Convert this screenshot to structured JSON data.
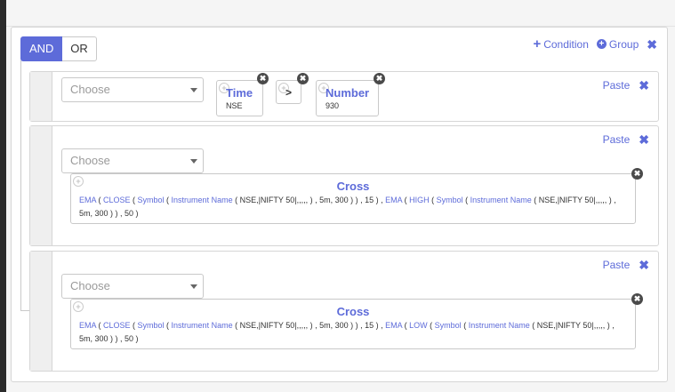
{
  "logic": {
    "and_label": "AND",
    "or_label": "OR"
  },
  "actions": {
    "condition_label": "Condition",
    "group_label": "Group"
  },
  "rules": {
    "r1": {
      "paste_label": "Paste",
      "select_placeholder": "Choose",
      "left_chip": {
        "title": "Time",
        "sub": "NSE"
      },
      "operator": ">",
      "right_chip": {
        "title": "Number",
        "sub": "930"
      }
    },
    "r2": {
      "paste_label": "Paste",
      "select_placeholder": "Choose",
      "title": "Cross",
      "expr": [
        "EMA",
        " ( ",
        "CLOSE",
        " ( ",
        "Symbol",
        " ( ",
        "Instrument Name",
        " ( NSE,|NIFTY 50|,,,,, ) , 5m, 300 ) ) , 15 ) , ",
        "EMA",
        " ( ",
        "HIGH",
        " ( ",
        "Symbol",
        " ( ",
        "Instrument Name",
        " ( NSE,|NIFTY 50|,,,,, ) , 5m, 300 ) ) , 50 )"
      ]
    },
    "r3": {
      "paste_label": "Paste",
      "select_placeholder": "Choose",
      "title": "Cross",
      "expr": [
        "EMA",
        " ( ",
        "CLOSE",
        " ( ",
        "Symbol",
        " ( ",
        "Instrument Name",
        " ( NSE,|NIFTY 50|,,,,, ) , 5m, 300 ) ) , 15 ) , ",
        "EMA",
        " ( ",
        "LOW",
        " ( ",
        "Symbol",
        " ( ",
        "Instrument Name",
        " ( NSE,|NIFTY 50|,,,,, ) , 5m, 300 ) ) , 50 )"
      ]
    }
  },
  "icons": {
    "plus": "plus-icon",
    "circle_plus": "circle-plus-icon",
    "close": "close-icon",
    "caret": "caret-down-icon"
  },
  "colors": {
    "accent": "#5d6bd9",
    "dark_badge": "#4a4a4a",
    "border": "#c9c9c9"
  }
}
